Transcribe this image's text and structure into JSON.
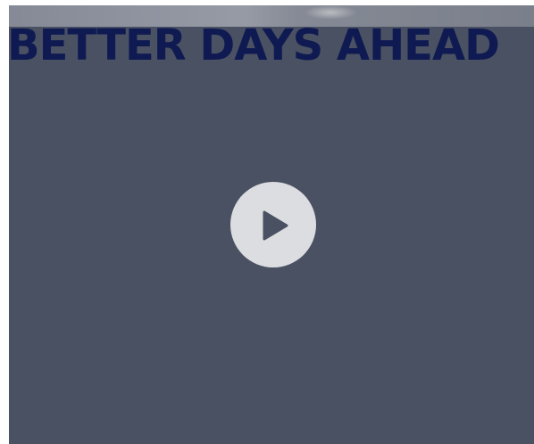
{
  "video": {
    "headline": "BETTER DAYS AHEAD",
    "play_icon": "play-icon",
    "colors": {
      "overlay": "#4a5162",
      "headline": "#0f1a52",
      "play_button": "#dcdde0",
      "play_glyph": "#4a5162"
    }
  }
}
